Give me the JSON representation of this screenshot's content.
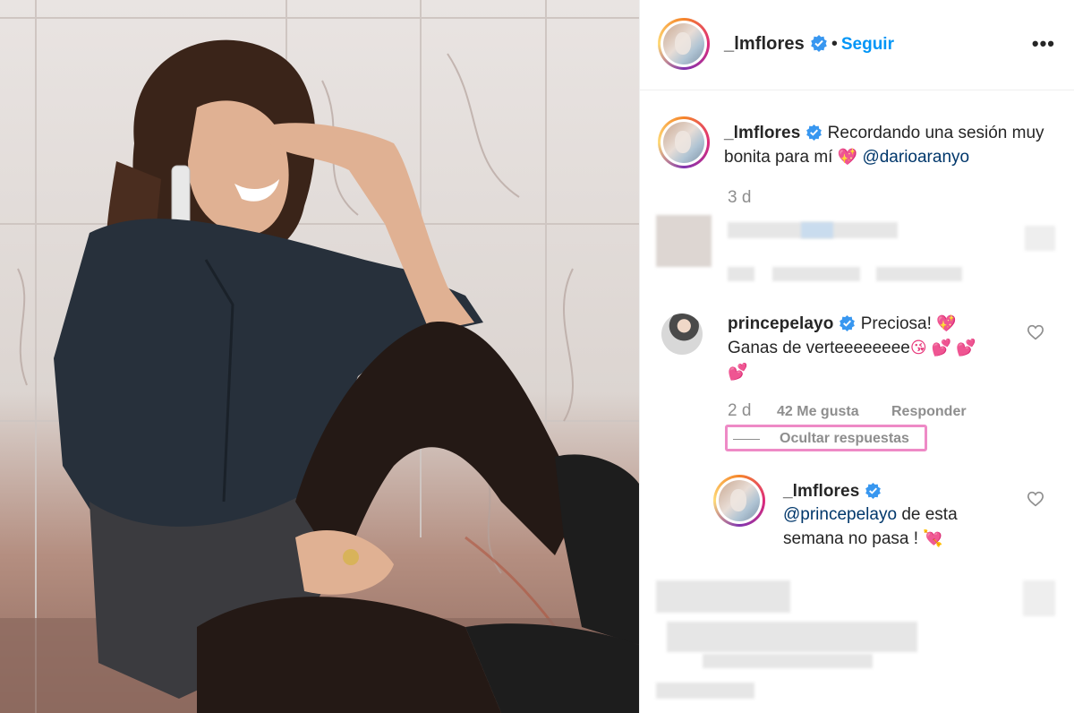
{
  "post": {
    "username": "_lmflores",
    "separator": "•",
    "follow_label": "Seguir",
    "more_label": "•••"
  },
  "caption": {
    "username": "_lmflores",
    "text": "Recordando una sesión muy bonita para mí",
    "emoji": "💖",
    "mention": "@darioaranyo",
    "time": "3 d"
  },
  "comments": [
    {
      "username": "princepelayo",
      "text_line1": "Preciosa!",
      "emoji1": "💖",
      "text_line2": "Ganas de verteeeeeeee",
      "emoji2": "😘 💕 💕",
      "emoji3": "💕",
      "time": "2 d",
      "likes": "42 Me gusta",
      "reply_label": "Responder",
      "hide_replies_label": "Ocultar respuestas"
    }
  ],
  "reply": {
    "username": "_lmflores",
    "mention": "@princepelayo",
    "text": "de esta semana no pasa !",
    "emoji": "💘"
  },
  "icons": {
    "verified": "verified-badge-icon",
    "heart": "heart-outline-icon",
    "more": "more-options-icon"
  },
  "colors": {
    "accent": "#0095f6",
    "verified": "#3897f0",
    "highlight": "#ee8ac6",
    "muted": "#8e8e8e",
    "mention": "#00376b"
  }
}
